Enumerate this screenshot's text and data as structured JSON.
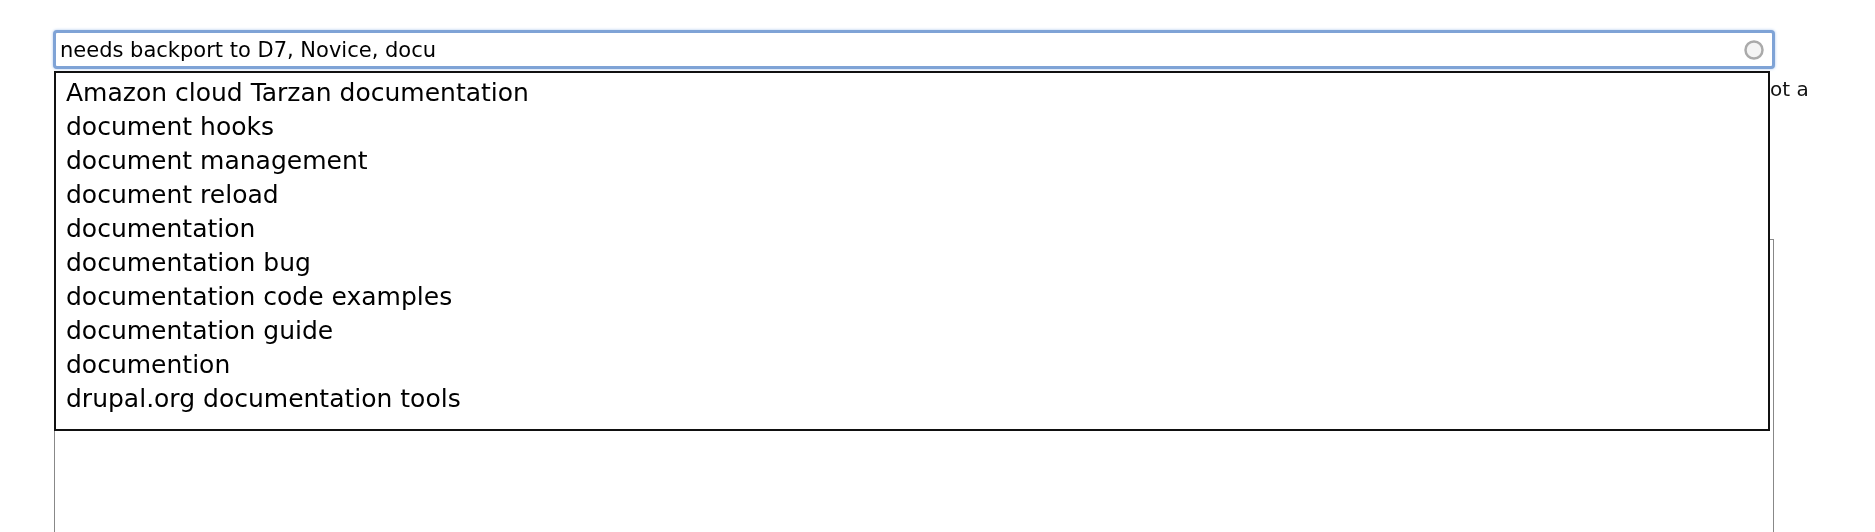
{
  "tags_field": {
    "value": "needs backport to D7, Novice, docu"
  },
  "suggestions": [
    {
      "label": "Amazon cloud Tarzan documentation"
    },
    {
      "label": "document hooks"
    },
    {
      "label": "document management"
    },
    {
      "label": "document reload"
    },
    {
      "label": "documentation"
    },
    {
      "label": "documentation bug"
    },
    {
      "label": "documentation code examples"
    },
    {
      "label": "documentation guide"
    },
    {
      "label": "documention"
    },
    {
      "label": "drupal.org documentation tools"
    }
  ],
  "description_fragment": "ot a"
}
